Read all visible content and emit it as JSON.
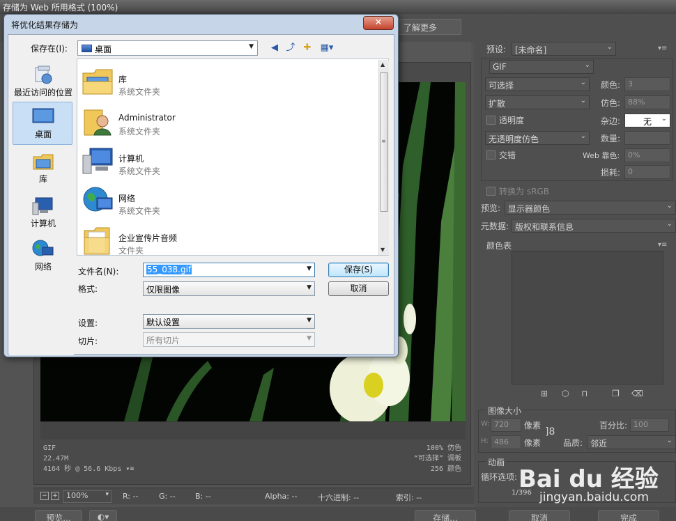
{
  "window": {
    "title": "存储为 Web 所用格式 (100%)"
  },
  "toolbar": {
    "learn_more": "了解更多"
  },
  "preview_info": {
    "left_lines": [
      "GIF",
      "22.47M",
      "4164 秒 @ 56.6 Kbps ▾≡"
    ],
    "right_lines": [
      "100% 仿色",
      "“可选择” 调板",
      "256 颜色"
    ]
  },
  "status_bar": {
    "zoom": "100%",
    "r": "R: --",
    "g": "G: --",
    "b": "B: --",
    "alpha": "Alpha: --",
    "hex": "十六进制: --",
    "index": "索引: --"
  },
  "bottom_buttons": {
    "preview": "预览...",
    "save": "存储...",
    "cancel": "取消",
    "done": "完成"
  },
  "settings": {
    "preset_label": "预设:",
    "preset_value": "[未命名]",
    "format_value": "GIF",
    "reduction_value": "可选择",
    "dither_algo_value": "扩散",
    "colors_label": "颜色:",
    "colors_value": "3",
    "dither_label": "仿色:",
    "dither_value": "88%",
    "transparency_label": "透明度",
    "matte_label": "杂边:",
    "matte_value": "无",
    "transparency_dither_value": "无透明度仿色",
    "amount_label": "数量:",
    "interlaced_label": "交错",
    "web_snap_label": "Web 靠色:",
    "web_snap_value": "0%",
    "lossy_label": "损耗:",
    "lossy_value": "0",
    "convert_srgb_label": "转换为 sRGB",
    "preview_label": "预览:",
    "preview_value": "显示器颜色",
    "metadata_label": "元数据:",
    "metadata_value": "版权和联系信息",
    "color_table_label": "颜色表"
  },
  "image_size": {
    "title": "图像大小",
    "w_label": "W:",
    "w_value": "720",
    "h_label": "H:",
    "h_value": "486",
    "unit": "像素",
    "percent_label": "百分比:",
    "percent_value": "100",
    "quality_label": "品质:",
    "quality_value": "邻近"
  },
  "animation": {
    "title": "动画",
    "loop_label": "循环选项:",
    "frame_counter": "1/396"
  },
  "dialog": {
    "title": "将优化结果存储为",
    "close_symbol": "✕",
    "save_in_label": "保存在(I):",
    "save_in_value": "桌面",
    "places": [
      {
        "label": "最近访问的位置",
        "icon": "recent-places-icon"
      },
      {
        "label": "桌面",
        "icon": "desktop-icon"
      },
      {
        "label": "库",
        "icon": "library-icon"
      },
      {
        "label": "计算机",
        "icon": "computer-icon"
      },
      {
        "label": "网络",
        "icon": "network-icon"
      }
    ],
    "files": [
      {
        "name": "库",
        "type": "系统文件夹",
        "icon": "library-icon"
      },
      {
        "name": "Administrator",
        "type": "系统文件夹",
        "icon": "user-folder-icon"
      },
      {
        "name": "计算机",
        "type": "系统文件夹",
        "icon": "computer-icon"
      },
      {
        "name": "网络",
        "type": "系统文件夹",
        "icon": "network-icon"
      },
      {
        "name": "企业宣传片音频",
        "type": "文件夹",
        "icon": "folder-icon"
      }
    ],
    "filename_label": "文件名(N):",
    "filename_value": "55_038.gif",
    "format_label": "格式:",
    "format_value": "仅限图像",
    "settings_label": "设置:",
    "settings_value": "默认设置",
    "slices_label": "切片:",
    "slices_value": "所有切片",
    "save_button": "保存(S)",
    "cancel_button": "取消"
  },
  "watermark": {
    "logo": "Bai du 经验",
    "url": "jingyan.baidu.com"
  }
}
